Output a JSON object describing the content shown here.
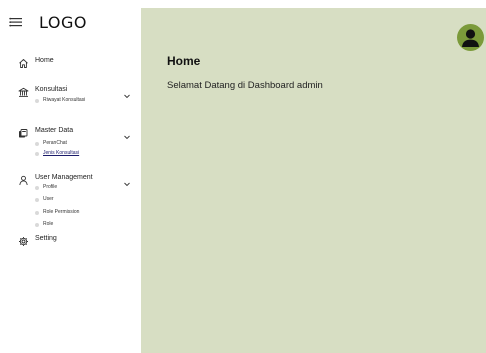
{
  "header": {
    "logo_text": "LOGO"
  },
  "sidebar": {
    "items": [
      {
        "label": "Home",
        "icon": "home-icon"
      },
      {
        "label": "Konsultasi",
        "icon": "institution-icon",
        "sub": [
          "Riwayat Konsultasi"
        ]
      },
      {
        "label": "Master Data",
        "icon": "database-icon",
        "sub": [
          "PeranChat",
          "Jenis Konsultasi"
        ]
      },
      {
        "label": "User Management",
        "icon": "user-icon",
        "sub": [
          "Profile",
          "User",
          "Role Permission",
          "Role"
        ]
      },
      {
        "label": "Setting",
        "icon": "gear-icon"
      }
    ],
    "active_sub": "Jenis Konsultasi"
  },
  "main": {
    "title": "Home",
    "welcome": "Selamat Datang di Dashboard admin"
  },
  "colors": {
    "main_background": "#d7dec3",
    "avatar_background": "#7b9a3a",
    "sub_dot": "#d9d9d9"
  }
}
